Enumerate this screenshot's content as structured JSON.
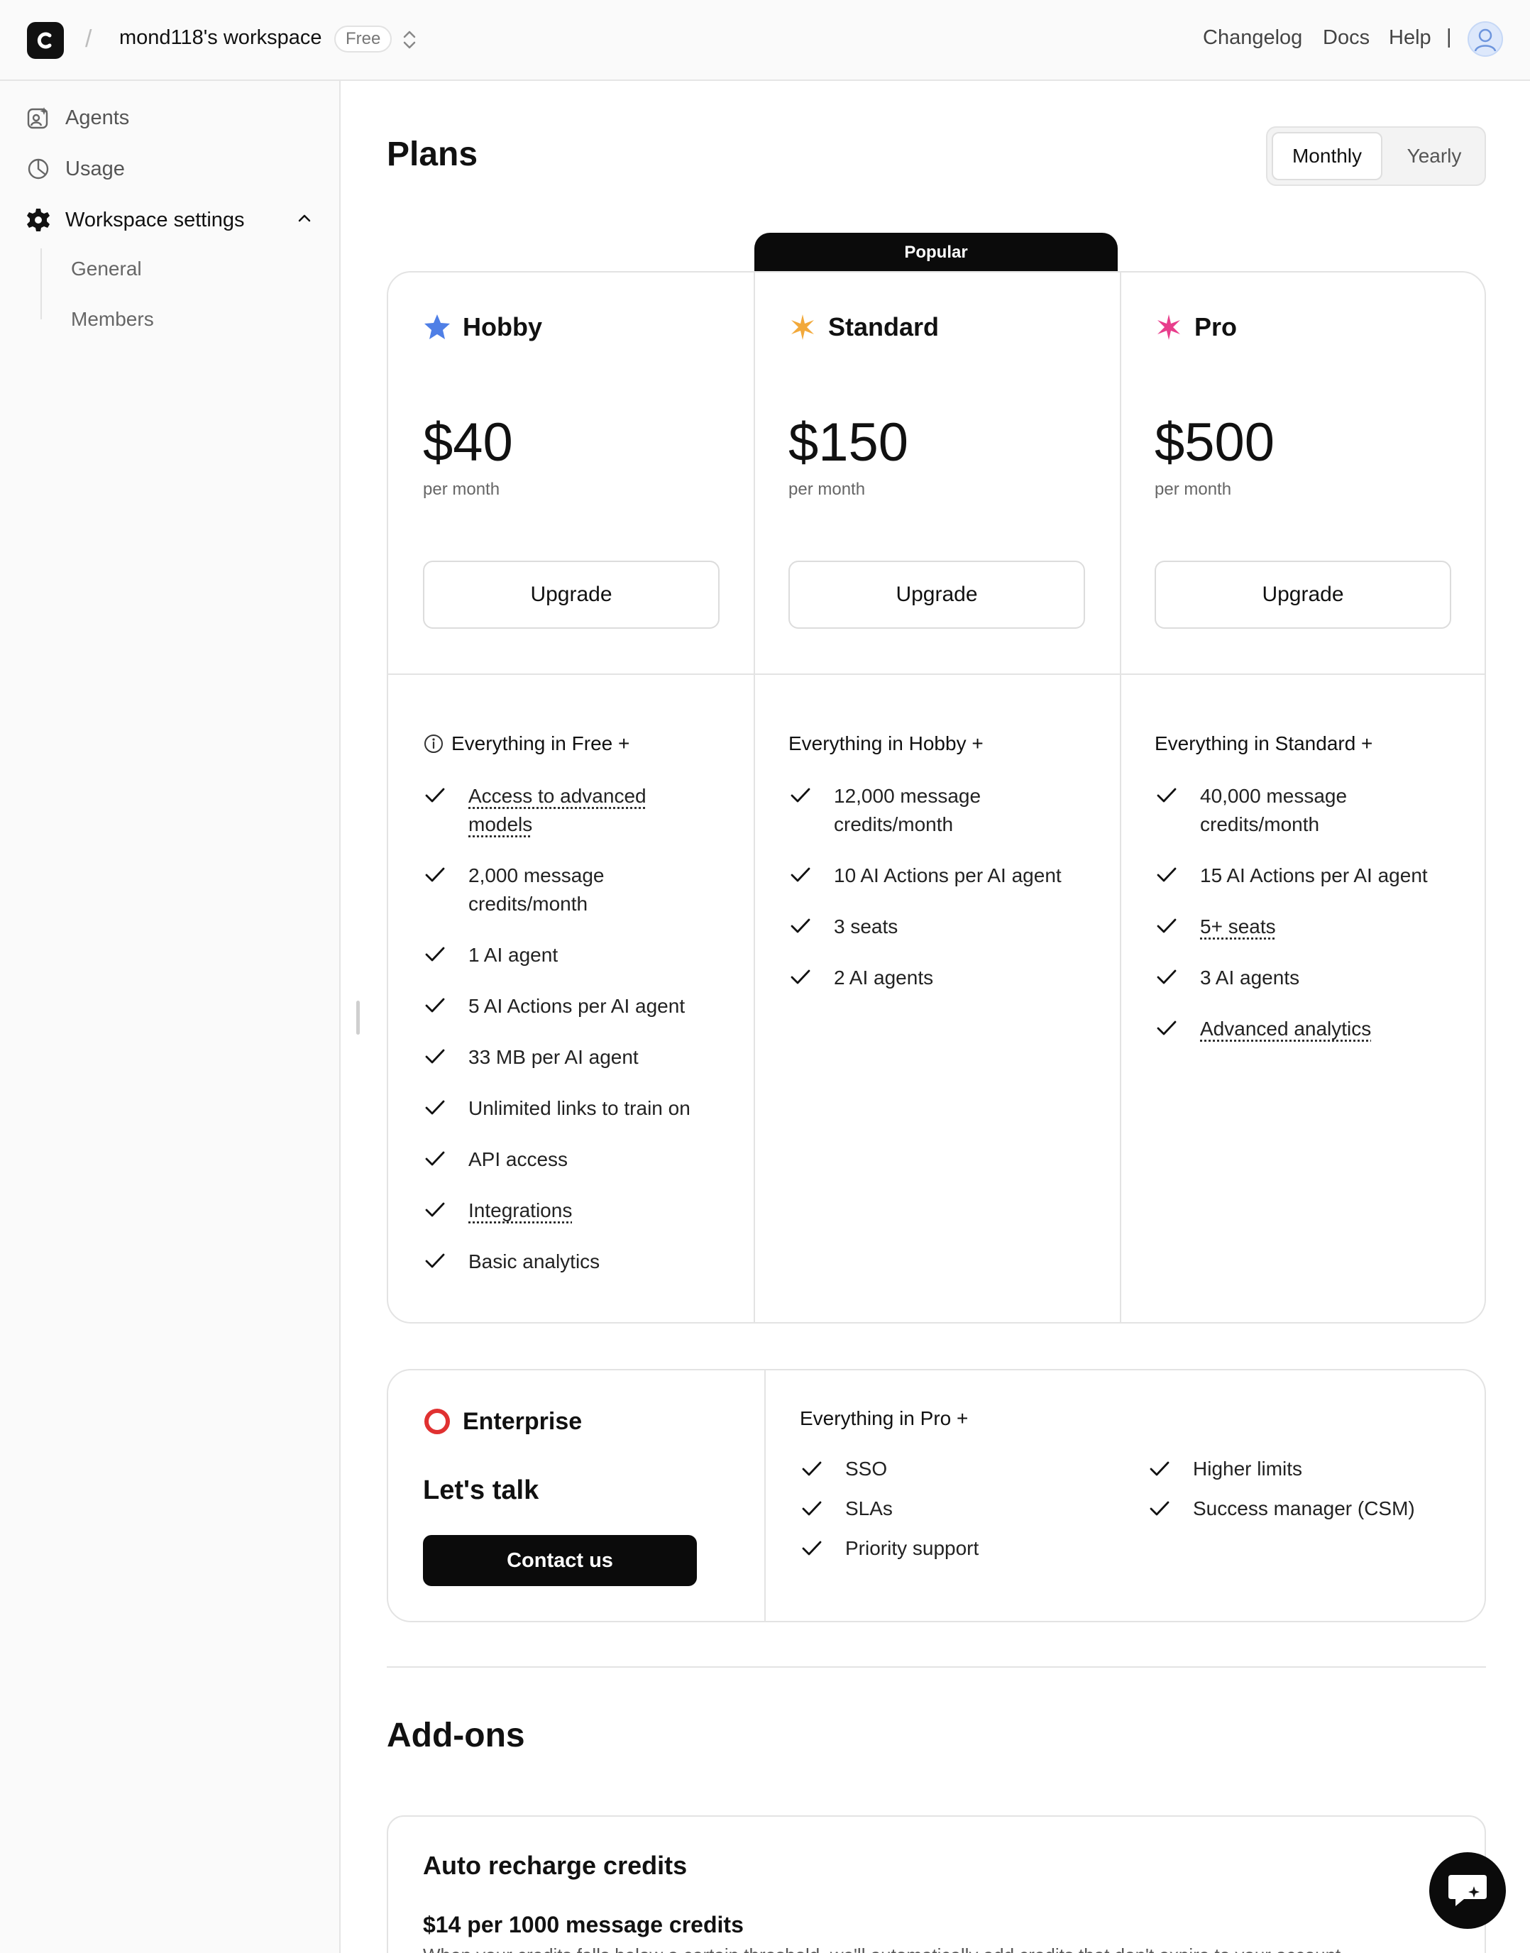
{
  "header": {
    "workspace_name": "mond118's workspace",
    "plan_badge": "Free",
    "links": [
      "Changelog",
      "Docs",
      "Help"
    ],
    "separator": "|"
  },
  "sidebar": {
    "items": [
      {
        "label": "Agents",
        "icon": "agents-icon"
      },
      {
        "label": "Usage",
        "icon": "usage-icon"
      },
      {
        "label": "Workspace settings",
        "icon": "gear-icon"
      }
    ],
    "sub_items": [
      "General",
      "Members"
    ]
  },
  "main": {
    "title": "Plans",
    "billing_toggle": {
      "options": [
        "Monthly",
        "Yearly"
      ],
      "selected": "Monthly"
    },
    "popular_label": "Popular",
    "plans": [
      {
        "name": "Hobby",
        "price": "$40",
        "period": "per month",
        "button": "Upgrade",
        "icon_color": "#4f7fe6",
        "features_heading": "Everything in Free +",
        "features": [
          "Access to advanced models",
          "2,000 message credits/month",
          "1 AI agent",
          "5 AI Actions per AI agent",
          "33 MB per AI agent",
          "Unlimited links to train on",
          "API access",
          "Integrations",
          "Basic analytics"
        ]
      },
      {
        "name": "Standard",
        "price": "$150",
        "period": "per month",
        "button": "Upgrade",
        "icon_color": "#f2a93b",
        "features_heading": "Everything in Hobby +",
        "features": [
          "12,000 message credits/month",
          "10 AI Actions per AI agent",
          "3 seats",
          "2 AI agents"
        ]
      },
      {
        "name": "Pro",
        "price": "$500",
        "period": "per month",
        "button": "Upgrade",
        "icon_color": "#e83e8c",
        "features_heading": "Everything in Standard +",
        "features": [
          "40,000 message credits/month",
          "15 AI Actions per AI agent",
          "5+ seats",
          "3 AI agents",
          "Advanced analytics"
        ]
      }
    ],
    "enterprise": {
      "name": "Enterprise",
      "tagline": "Let's talk",
      "button": "Contact us",
      "features_heading": "Everything in Pro +",
      "features": [
        "SSO",
        "SLAs",
        "Priority support",
        "Higher limits",
        "Success manager (CSM)"
      ]
    },
    "addons": {
      "title": "Add-ons",
      "auto_recharge": {
        "title": "Auto recharge credits",
        "price": "$14 per 1000 message credits",
        "description": "When your credits falls below a certain threshold, we'll automatically add credits that don't expire to your account."
      }
    }
  }
}
